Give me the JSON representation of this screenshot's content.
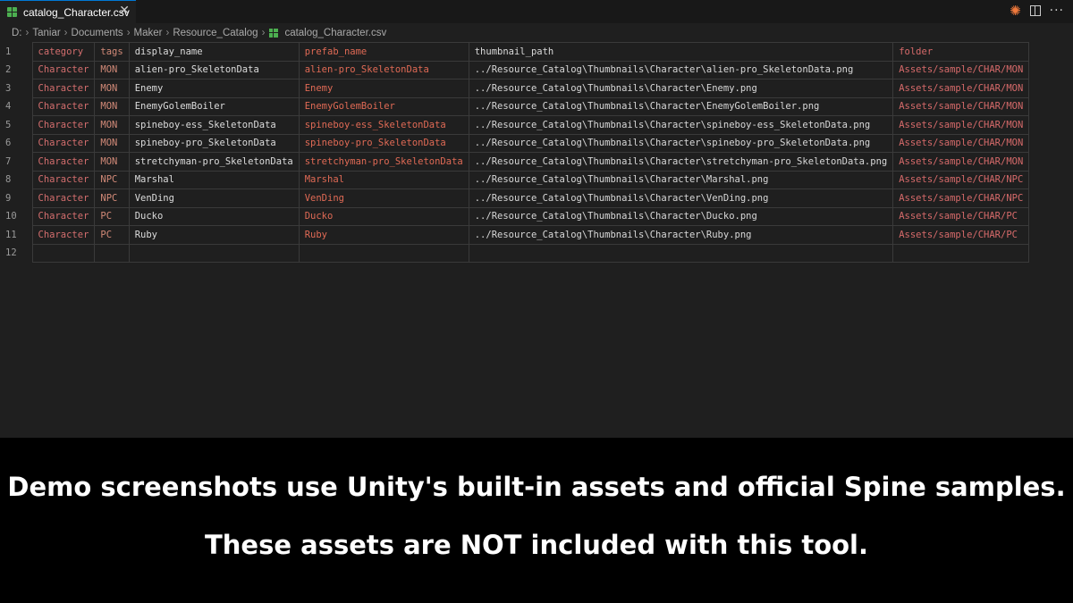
{
  "tab": {
    "title": "catalog_Character.csv",
    "close": "✕"
  },
  "breadcrumb": [
    "D:",
    "Taniar",
    "Documents",
    "Maker",
    "Resource_Catalog",
    "catalog_Character.csv"
  ],
  "header": {
    "line": "1",
    "cells": [
      "category",
      "tags",
      "display_name",
      "prefab_name",
      "thumbnail_path",
      "folder"
    ]
  },
  "rows": [
    {
      "line": "2",
      "cells": [
        "Character",
        "MON",
        "alien-pro_SkeletonData",
        "alien-pro_SkeletonData",
        "../Resource_Catalog\\Thumbnails\\Character\\alien-pro_SkeletonData.png",
        "Assets/sample/CHAR/MON"
      ]
    },
    {
      "line": "3",
      "cells": [
        "Character",
        "MON",
        "Enemy",
        "Enemy",
        "../Resource_Catalog\\Thumbnails\\Character\\Enemy.png",
        "Assets/sample/CHAR/MON"
      ]
    },
    {
      "line": "4",
      "cells": [
        "Character",
        "MON",
        "EnemyGolemBoiler",
        "EnemyGolemBoiler",
        "../Resource_Catalog\\Thumbnails\\Character\\EnemyGolemBoiler.png",
        "Assets/sample/CHAR/MON"
      ]
    },
    {
      "line": "5",
      "cells": [
        "Character",
        "MON",
        "spineboy-ess_SkeletonData",
        "spineboy-ess_SkeletonData",
        "../Resource_Catalog\\Thumbnails\\Character\\spineboy-ess_SkeletonData.png",
        "Assets/sample/CHAR/MON"
      ]
    },
    {
      "line": "6",
      "cells": [
        "Character",
        "MON",
        "spineboy-pro_SkeletonData",
        "spineboy-pro_SkeletonData",
        "../Resource_Catalog\\Thumbnails\\Character\\spineboy-pro_SkeletonData.png",
        "Assets/sample/CHAR/MON"
      ]
    },
    {
      "line": "7",
      "cells": [
        "Character",
        "MON",
        "stretchyman-pro_SkeletonData",
        "stretchyman-pro_SkeletonData",
        "../Resource_Catalog\\Thumbnails\\Character\\stretchyman-pro_SkeletonData.png",
        "Assets/sample/CHAR/MON"
      ]
    },
    {
      "line": "8",
      "cells": [
        "Character",
        "NPC",
        "Marshal",
        "Marshal",
        "../Resource_Catalog\\Thumbnails\\Character\\Marshal.png",
        "Assets/sample/CHAR/NPC"
      ]
    },
    {
      "line": "9",
      "cells": [
        "Character",
        "NPC",
        "VenDing",
        "VenDing",
        "../Resource_Catalog\\Thumbnails\\Character\\VenDing.png",
        "Assets/sample/CHAR/NPC"
      ]
    },
    {
      "line": "10",
      "cells": [
        "Character",
        "PC",
        "Ducko",
        "Ducko",
        "../Resource_Catalog\\Thumbnails\\Character\\Ducko.png",
        "Assets/sample/CHAR/PC"
      ]
    },
    {
      "line": "11",
      "cells": [
        "Character",
        "PC",
        "Ruby",
        "Ruby",
        "../Resource_Catalog\\Thumbnails\\Character\\Ruby.png",
        "Assets/sample/CHAR/PC"
      ]
    },
    {
      "line": "12",
      "cells": [
        "",
        "",
        "",
        "",
        "",
        ""
      ]
    }
  ],
  "caption": {
    "line1": "Demo screenshots use Unity's built-in assets and official Spine samples.",
    "line2": "These assets are NOT included with this tool."
  }
}
